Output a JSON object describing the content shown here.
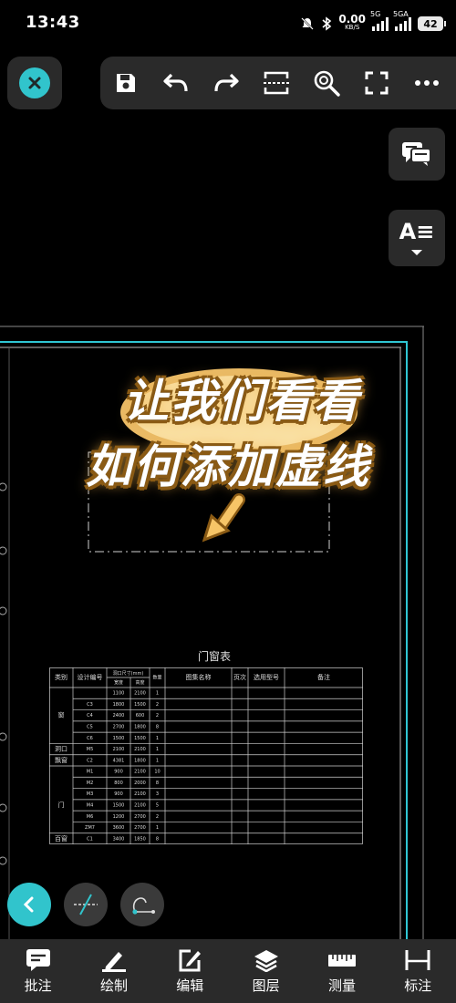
{
  "status_bar": {
    "time": "13:43",
    "net_speed": "0.00",
    "net_unit": "KB/S",
    "sig1_tag": "5G",
    "sig2_tag": "5GA",
    "battery": "42"
  },
  "toolbar": {
    "close_icon": "close-icon",
    "items": [
      {
        "name": "save-icon"
      },
      {
        "name": "undo-icon"
      },
      {
        "name": "redo-icon"
      },
      {
        "name": "scan-icon"
      },
      {
        "name": "zoom-icon"
      },
      {
        "name": "fullscreen-icon"
      },
      {
        "name": "more-icon"
      }
    ],
    "accent": "#31c4cc"
  },
  "side": {
    "comment_icon": "comment-icon",
    "text_icon_label": "A≡"
  },
  "promo": {
    "line1": "让我们看看",
    "line2": "如何添加虚线"
  },
  "table": {
    "title": "门窗表",
    "headers": {
      "category": "类别",
      "design_no": "设计编号",
      "size": "洞口尺寸(mm)",
      "width": "宽度",
      "height": "高度",
      "qty": "数量",
      "atlas": "图集名称",
      "page": "页次",
      "model": "选用型号",
      "remark": "备注"
    },
    "rows": [
      {
        "cat": "",
        "code": "",
        "w": "1100",
        "h": "2100",
        "q": "1"
      },
      {
        "cat": "",
        "code": "C3",
        "w": "1800",
        "h": "1500",
        "q": "2"
      },
      {
        "cat": "窗",
        "code": "C4",
        "w": "2400",
        "h": "600",
        "q": "2"
      },
      {
        "cat": "",
        "code": "C5",
        "w": "2700",
        "h": "1800",
        "q": "8"
      },
      {
        "cat": "",
        "code": "C6",
        "w": "1500",
        "h": "1500",
        "q": "1"
      },
      {
        "cat": "洞口",
        "code": "M5",
        "w": "2100",
        "h": "2100",
        "q": "1"
      },
      {
        "cat": "飘窗",
        "code": "C2",
        "w": "4381",
        "h": "1800",
        "q": "1"
      },
      {
        "cat": "",
        "code": "M1",
        "w": "900",
        "h": "2100",
        "q": "10"
      },
      {
        "cat": "",
        "code": "M2",
        "w": "800",
        "h": "2000",
        "q": "8"
      },
      {
        "cat": "",
        "code": "M3",
        "w": "900",
        "h": "2100",
        "q": "3"
      },
      {
        "cat": "门",
        "code": "M4",
        "w": "1500",
        "h": "2100",
        "q": "5"
      },
      {
        "cat": "",
        "code": "M6",
        "w": "1200",
        "h": "2700",
        "q": "2"
      },
      {
        "cat": "",
        "code": "ZM7",
        "w": "3600",
        "h": "2700",
        "q": "1"
      },
      {
        "cat": "百窗",
        "code": "C1",
        "w": "3400",
        "h": "1850",
        "q": "8"
      }
    ]
  },
  "fab": {
    "back_icon": "chevron-left-icon",
    "dash_icon": "dashed-line-icon",
    "curve_icon": "curve-icon"
  },
  "bottom_bar": {
    "items": [
      {
        "label": "批注",
        "icon": "comment-icon"
      },
      {
        "label": "绘制",
        "icon": "pencil-icon"
      },
      {
        "label": "编辑",
        "icon": "edit-icon"
      },
      {
        "label": "图层",
        "icon": "layers-icon"
      },
      {
        "label": "测量",
        "icon": "ruler-icon"
      },
      {
        "label": "标注",
        "icon": "dimension-icon"
      }
    ]
  }
}
